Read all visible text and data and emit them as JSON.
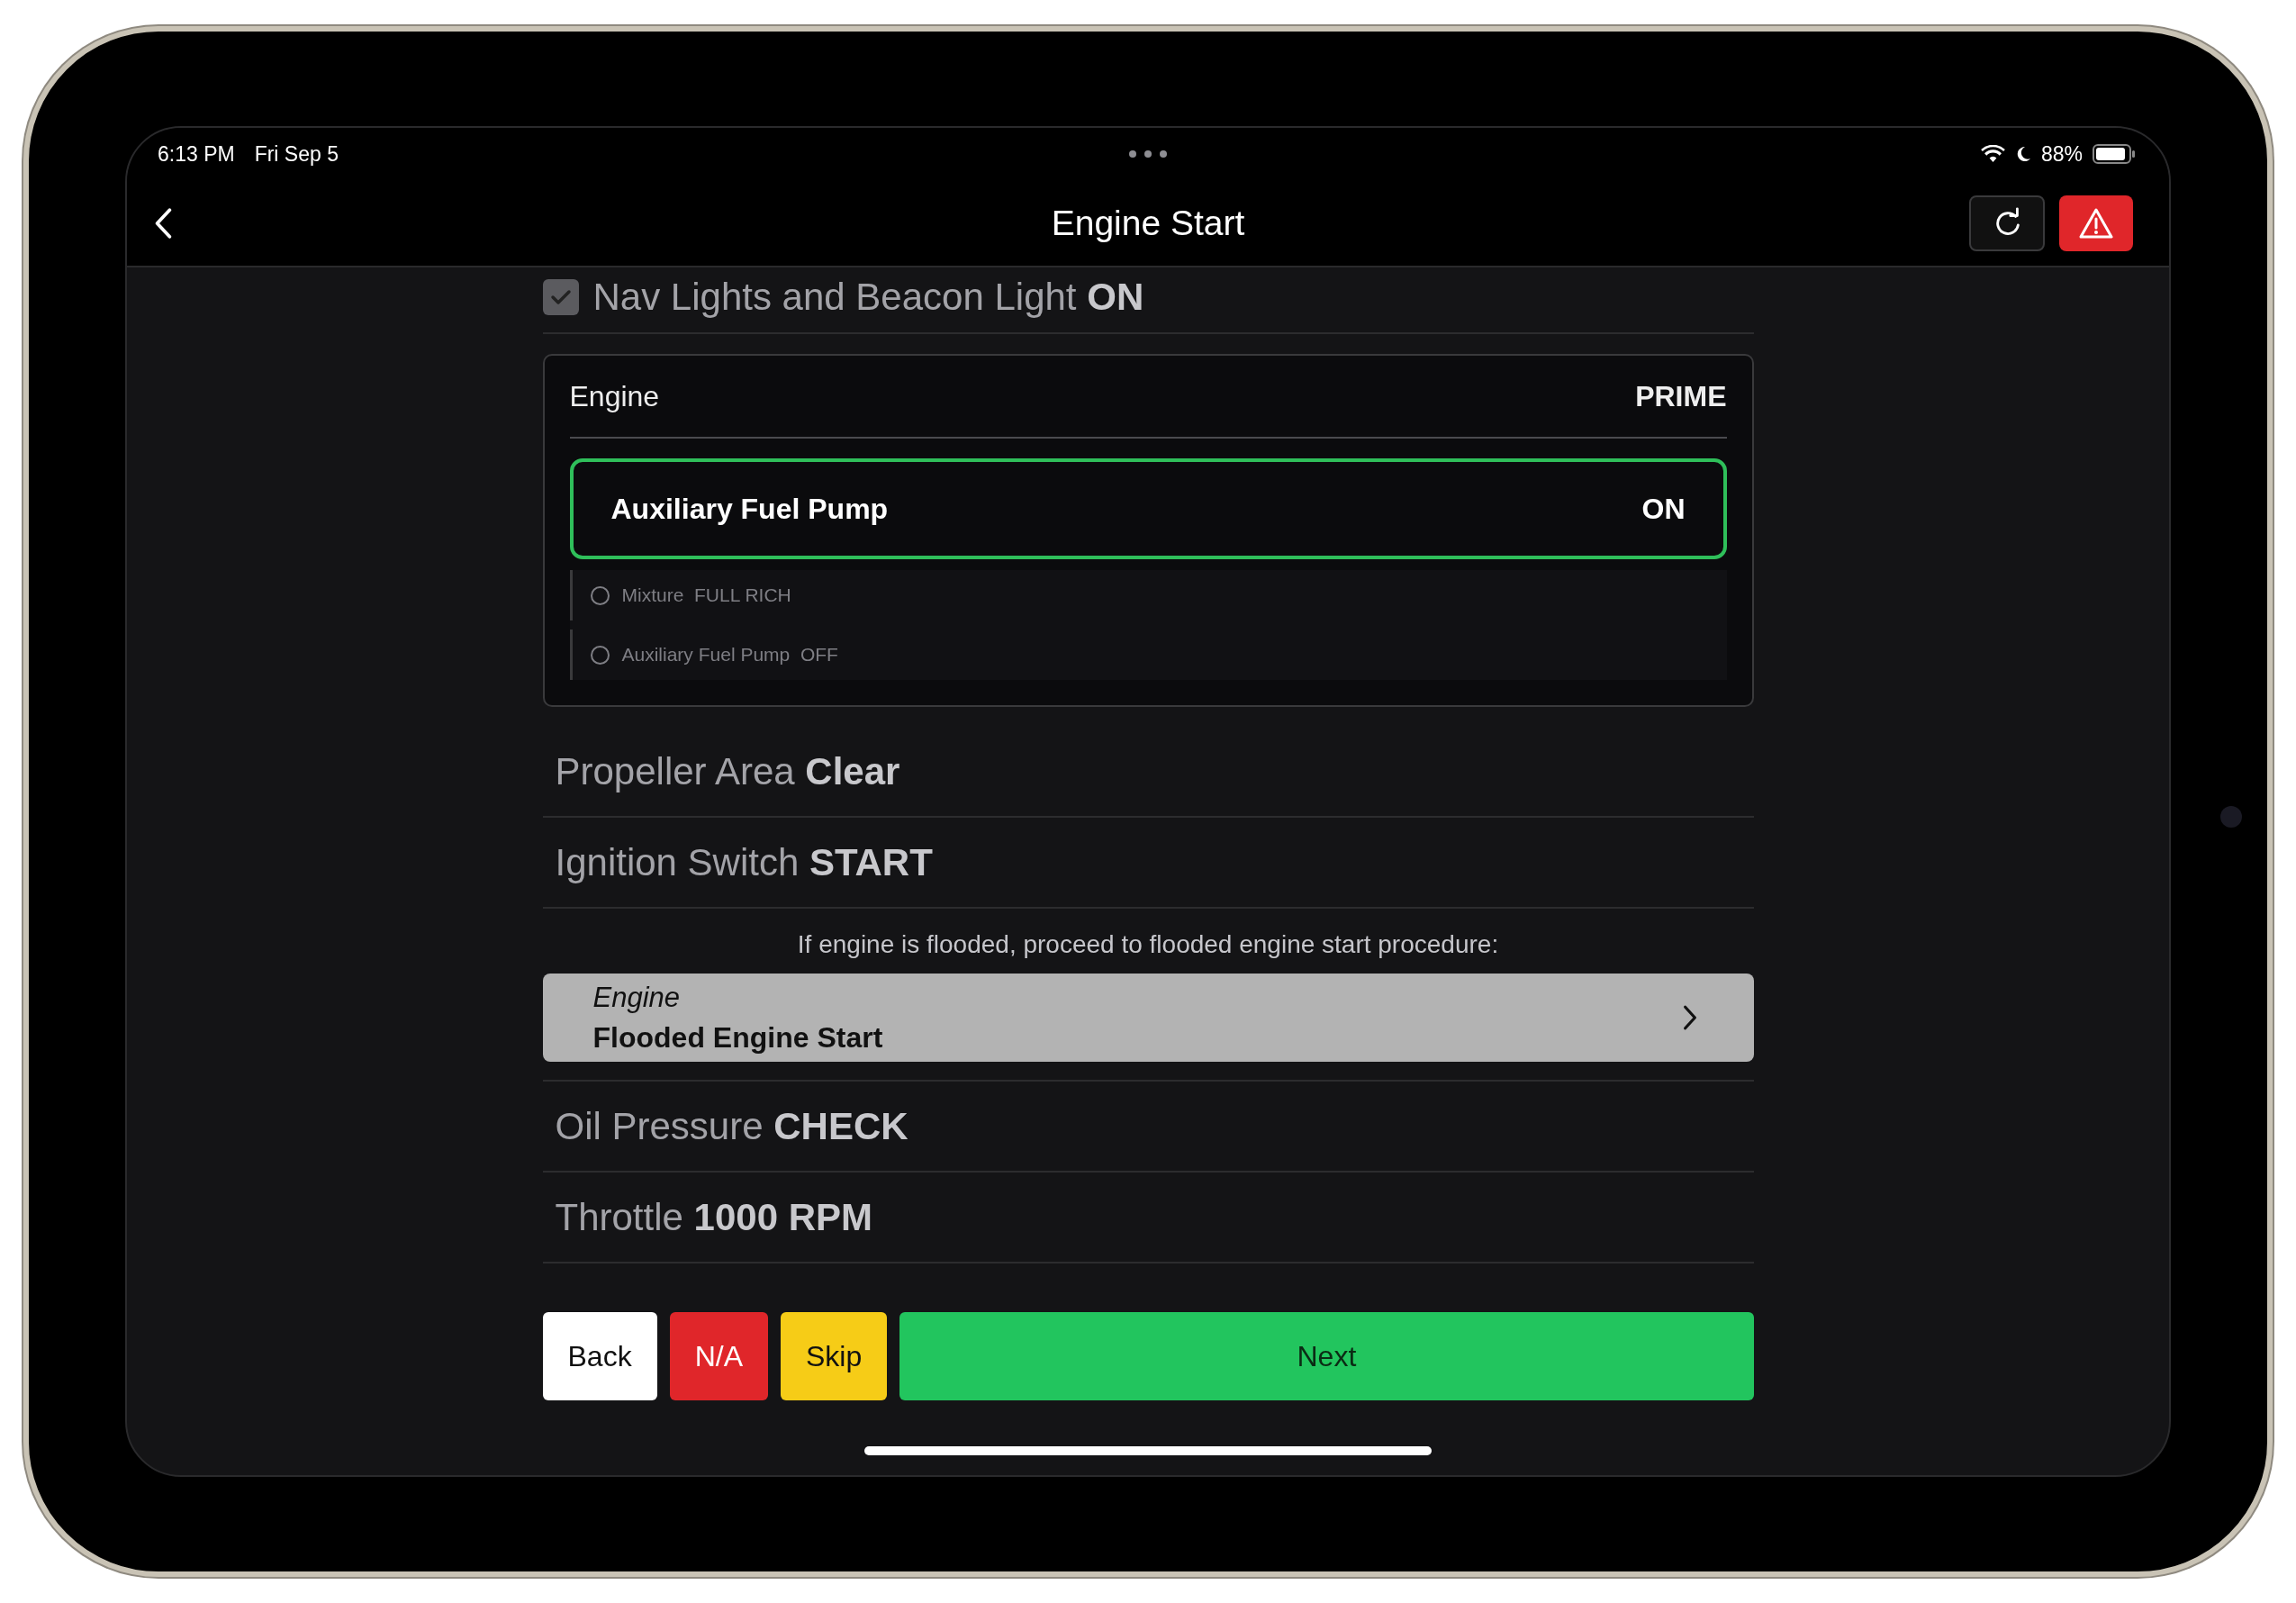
{
  "status_bar": {
    "time": "6:13 PM",
    "date": "Fri Sep 5",
    "battery": "88%"
  },
  "header": {
    "title": "Engine Start"
  },
  "steps": [
    {
      "kind": "item",
      "checked": true,
      "label": "Nav Lights and Beacon Light",
      "action": "ON"
    },
    {
      "kind": "group",
      "title": "Engine",
      "action": "PRIME",
      "current": {
        "label": "Auxiliary Fuel Pump",
        "action": "ON"
      },
      "substeps": [
        {
          "label": "Mixture",
          "action": "FULL RICH",
          "checked": false
        },
        {
          "label": "Auxiliary Fuel Pump",
          "action": "OFF",
          "checked": false
        }
      ]
    },
    {
      "kind": "item",
      "checked": false,
      "label": "Propeller Area",
      "action": "Clear"
    },
    {
      "kind": "item",
      "checked": false,
      "label": "Ignition Switch",
      "action": "START"
    },
    {
      "kind": "link",
      "note": "If engine is flooded, proceed to flooded engine start procedure:",
      "category": "Engine",
      "title": "Flooded Engine Start"
    },
    {
      "kind": "item",
      "checked": false,
      "label": "Oil Pressure",
      "action": "CHECK"
    },
    {
      "kind": "item",
      "checked": false,
      "label": "Throttle",
      "action": "1000 RPM"
    }
  ],
  "buttons": [
    {
      "kind": "back",
      "label": "Back"
    },
    {
      "kind": "na",
      "label": "N/A"
    },
    {
      "kind": "skip",
      "label": "Skip"
    },
    {
      "kind": "next",
      "label": "Next"
    }
  ]
}
